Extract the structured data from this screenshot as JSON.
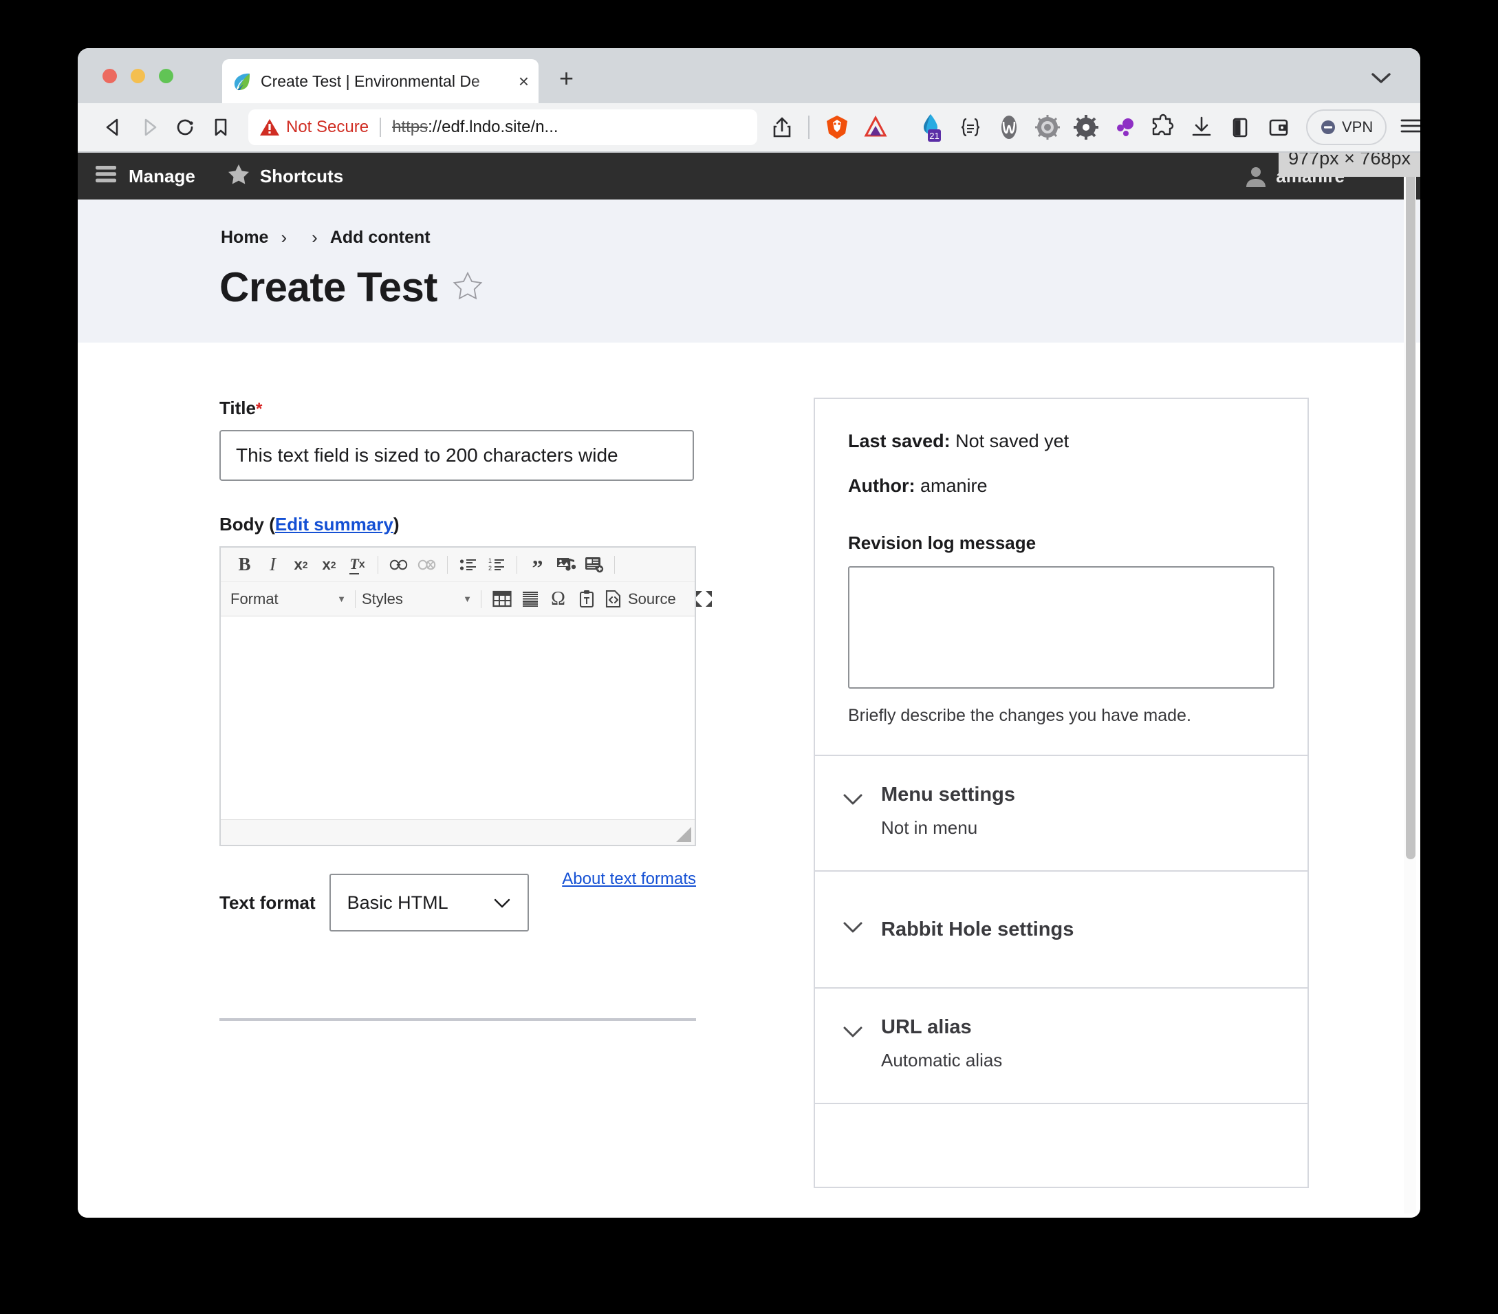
{
  "browser": {
    "tab": {
      "title": "Create Test | Environmental De",
      "favicon": "edf-leaf-logo",
      "close_label": "×"
    },
    "new_tab_label": "+",
    "nav": {
      "back": "back-arrow",
      "forward": "forward-arrow",
      "reload": "reload-arrow",
      "bookmark": "bookmark-flag"
    },
    "url_bar": {
      "security_status": "Not Secure",
      "scheme": "https",
      "url_rest": "://edf.lndo.site/n...",
      "share": "share-icon"
    },
    "extensions": [
      {
        "name": "brave-lion-icon"
      },
      {
        "name": "brave-rewards-triangle-icon"
      },
      {
        "name": "grammar-drop-icon",
        "badge": "21"
      },
      {
        "name": "code-braces-icon"
      },
      {
        "name": "wave-w-icon"
      },
      {
        "name": "gear-light-icon"
      },
      {
        "name": "gear-dark-icon"
      },
      {
        "name": "purple-dots-icon"
      },
      {
        "name": "puzzle-extension-icon"
      },
      {
        "name": "download-icon"
      },
      {
        "name": "sidebar-panel-icon"
      },
      {
        "name": "wallet-icon"
      }
    ],
    "vpn_label": "VPN",
    "menu": "hamburger-menu-icon"
  },
  "admin_toolbar": {
    "manage_label": "Manage",
    "shortcuts_label": "Shortcuts",
    "user_name": "amanire"
  },
  "size_tooltip": "977px × 768px",
  "page": {
    "breadcrumb": [
      {
        "label": "Home"
      },
      {
        "label": ""
      },
      {
        "label": "Add content"
      }
    ],
    "breadcrumb_separator": "›",
    "title": "Create Test",
    "star_icon": "star-outline-icon"
  },
  "form": {
    "title_field": {
      "label": "Title",
      "required_mark": "*",
      "value": "This text field is sized to 200 characters wide"
    },
    "body_field": {
      "label_prefix": "Body (",
      "edit_summary_link": "Edit summary",
      "label_suffix": ")",
      "content": ""
    },
    "editor_toolbar_row1": [
      {
        "name": "bold-button",
        "label": "B",
        "disabled": false
      },
      {
        "name": "italic-button",
        "label": "I",
        "disabled": false
      },
      {
        "name": "superscript-button",
        "label": "x²",
        "disabled": false
      },
      {
        "name": "subscript-button",
        "label": "x₂",
        "disabled": false
      },
      {
        "name": "remove-format-button",
        "label": "Tx",
        "disabled": false
      },
      {
        "name": "link-button",
        "label": "link",
        "disabled": false
      },
      {
        "name": "unlink-button",
        "label": "unlink",
        "disabled": true
      },
      {
        "name": "bulleted-list-button",
        "label": "ul",
        "disabled": false
      },
      {
        "name": "numbered-list-button",
        "label": "ol",
        "disabled": false
      },
      {
        "name": "blockquote-button",
        "label": "”",
        "disabled": false
      },
      {
        "name": "media-button",
        "label": "media",
        "disabled": false
      },
      {
        "name": "insert-node-button",
        "label": "node",
        "disabled": false
      }
    ],
    "editor_toolbar_row2": {
      "format_label": "Format",
      "styles_label": "Styles",
      "table_button": "table-button",
      "horizontal-rule_button": "horizontal-rule-button",
      "special_char_button": "Ω",
      "paste_text_button": "paste-as-text-button",
      "source_label": "Source",
      "maximize_button": "maximize-button"
    },
    "text_format": {
      "label": "Text format",
      "value": "Basic HTML",
      "about_link": "About text formats"
    }
  },
  "sidebar": {
    "meta": {
      "last_saved_label": "Last saved:",
      "last_saved_value": "Not saved yet",
      "author_label": "Author:",
      "author_value": "amanire",
      "revision_log_label": "Revision log message",
      "revision_log_value": "",
      "revision_log_help": "Briefly describe the changes you have made."
    },
    "accordions": [
      {
        "title": "Menu settings",
        "summary": "Not in menu"
      },
      {
        "title": "Rabbit Hole settings",
        "summary": ""
      },
      {
        "title": "URL alias",
        "summary": "Automatic alias"
      }
    ]
  }
}
